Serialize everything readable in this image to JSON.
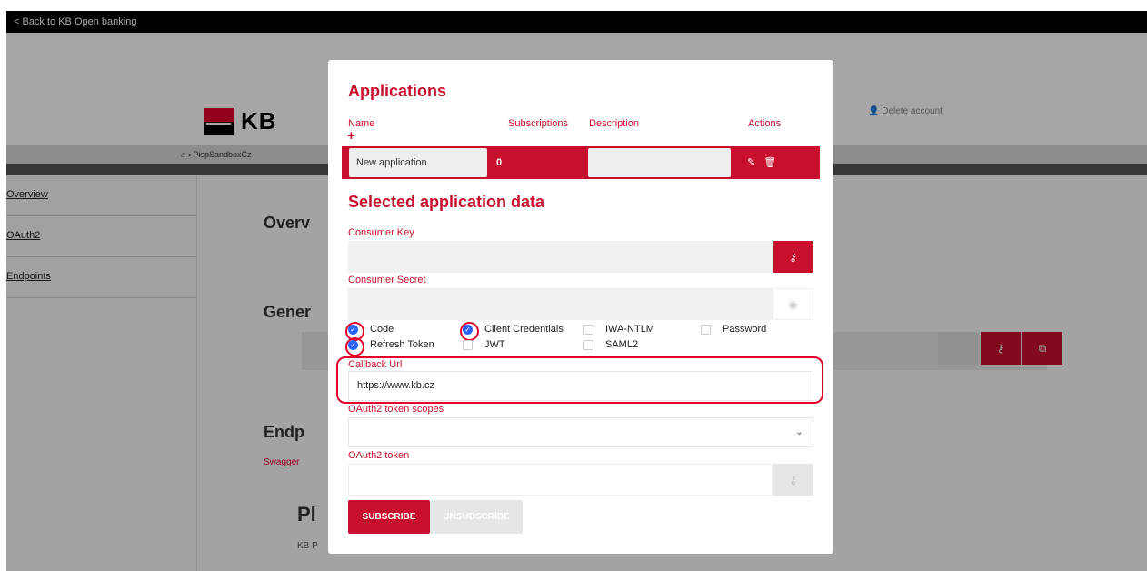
{
  "topbar": {
    "back_label": "< Back to KB Open banking"
  },
  "header": {
    "logo_text": "KB",
    "delete_account": "Delete account"
  },
  "breadcrumb": {
    "item": "PispSandboxCz"
  },
  "sidebar": {
    "items": [
      {
        "label": "Overview"
      },
      {
        "label": "OAuth2"
      },
      {
        "label": "Endpoints"
      }
    ]
  },
  "background": {
    "overview_heading": "Overv",
    "general_heading": "Gener",
    "endpoints_heading": "Endp",
    "swagger_text": "Swagger",
    "pl_heading": "Pl",
    "kb_text": "KB P"
  },
  "modal": {
    "title": "Applications",
    "columns": {
      "name": "Name",
      "subscriptions": "Subscriptions",
      "description": "Description",
      "actions": "Actions"
    },
    "add_icon": "+",
    "app_row": {
      "name": "New application",
      "subscriptions": "0",
      "description": ""
    },
    "selected_title": "Selected application data",
    "consumer_key_label": "Consumer Key",
    "consumer_secret_label": "Consumer Secret",
    "grants": [
      {
        "label": "Code",
        "checked": true
      },
      {
        "label": "Client Credentials",
        "checked": true
      },
      {
        "label": "IWA-NTLM",
        "checked": false
      },
      {
        "label": "Password",
        "checked": false
      },
      {
        "label": "Refresh Token",
        "checked": true
      },
      {
        "label": "JWT",
        "checked": false
      },
      {
        "label": "SAML2",
        "checked": false
      }
    ],
    "callback_label": "Callback Url",
    "callback_value": "https://www.kb.cz",
    "scopes_label": "OAuth2 token scopes",
    "token_label": "OAuth2 token",
    "subscribe_label": "SUBSCRIBE",
    "unsubscribe_label": "UNSUBSCRIBE"
  },
  "colors": {
    "brand_red": "#c8102e",
    "check_blue": "#2962ff",
    "highlight_red": "#e4002b"
  }
}
